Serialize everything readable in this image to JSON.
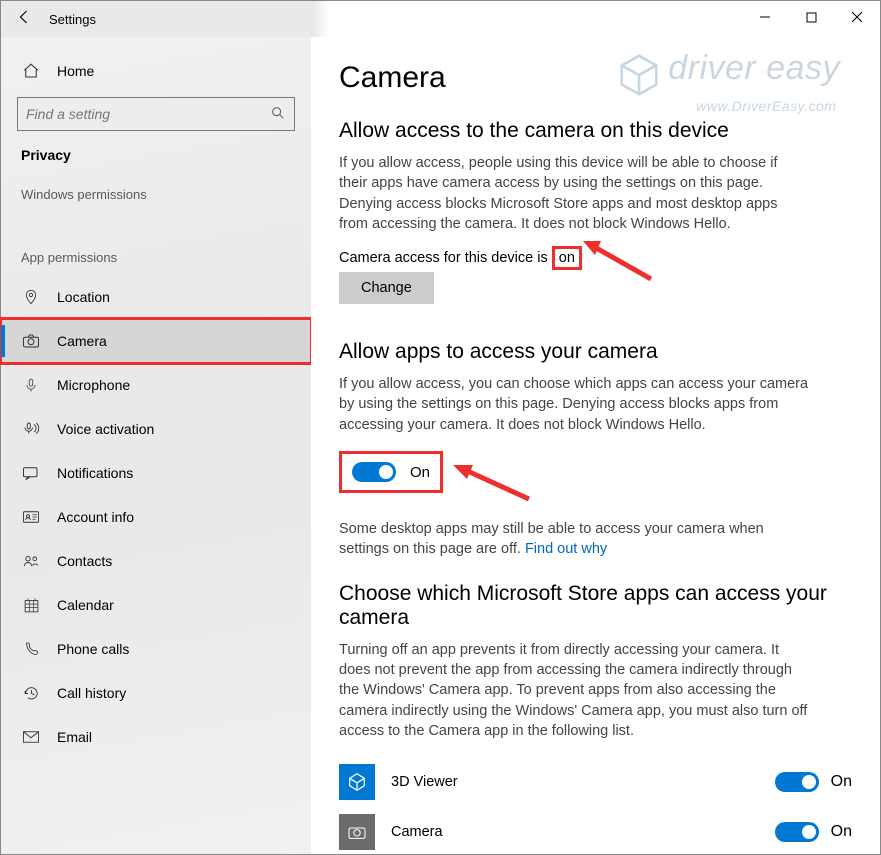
{
  "window": {
    "title": "Settings"
  },
  "sidebar": {
    "home": "Home",
    "search_placeholder": "Find a setting",
    "category": "Privacy",
    "group1": "Windows permissions",
    "group2": "App permissions",
    "items": {
      "location": "Location",
      "camera": "Camera",
      "microphone": "Microphone",
      "voice": "Voice activation",
      "notifications": "Notifications",
      "account": "Account info",
      "contacts": "Contacts",
      "calendar": "Calendar",
      "phone": "Phone calls",
      "callhistory": "Call history",
      "email": "Email"
    }
  },
  "main": {
    "title": "Camera",
    "s1": {
      "heading": "Allow access to the camera on this device",
      "desc": "If you allow access, people using this device will be able to choose if their apps have camera access by using the settings on this page. Denying access blocks Microsoft Store apps and most desktop apps from accessing the camera. It does not block Windows Hello.",
      "status_prefix": "Camera access for this device is ",
      "status_value": "on",
      "change": "Change"
    },
    "s2": {
      "heading": "Allow apps to access your camera",
      "desc": "If you allow access, you can choose which apps can access your camera by using the settings on this page. Denying access blocks apps from accessing your camera. It does not block Windows Hello.",
      "toggle_label": "On",
      "note_a": "Some desktop apps may still be able to access your camera when settings on this page are off. ",
      "note_link": "Find out why"
    },
    "s3": {
      "heading": "Choose which Microsoft Store apps can access your camera",
      "desc": "Turning off an app prevents it from directly accessing your camera. It does not prevent the app from accessing the camera indirectly through the Windows' Camera app. To prevent apps from also accessing the camera indirectly using the Windows' Camera app, you must also turn off access to the Camera app in the following list.",
      "apps": [
        {
          "name": "3D Viewer",
          "state": "On"
        },
        {
          "name": "Camera",
          "state": "On"
        }
      ]
    }
  },
  "watermark": {
    "brand": "driver easy",
    "url": "www.DriverEasy.com"
  }
}
